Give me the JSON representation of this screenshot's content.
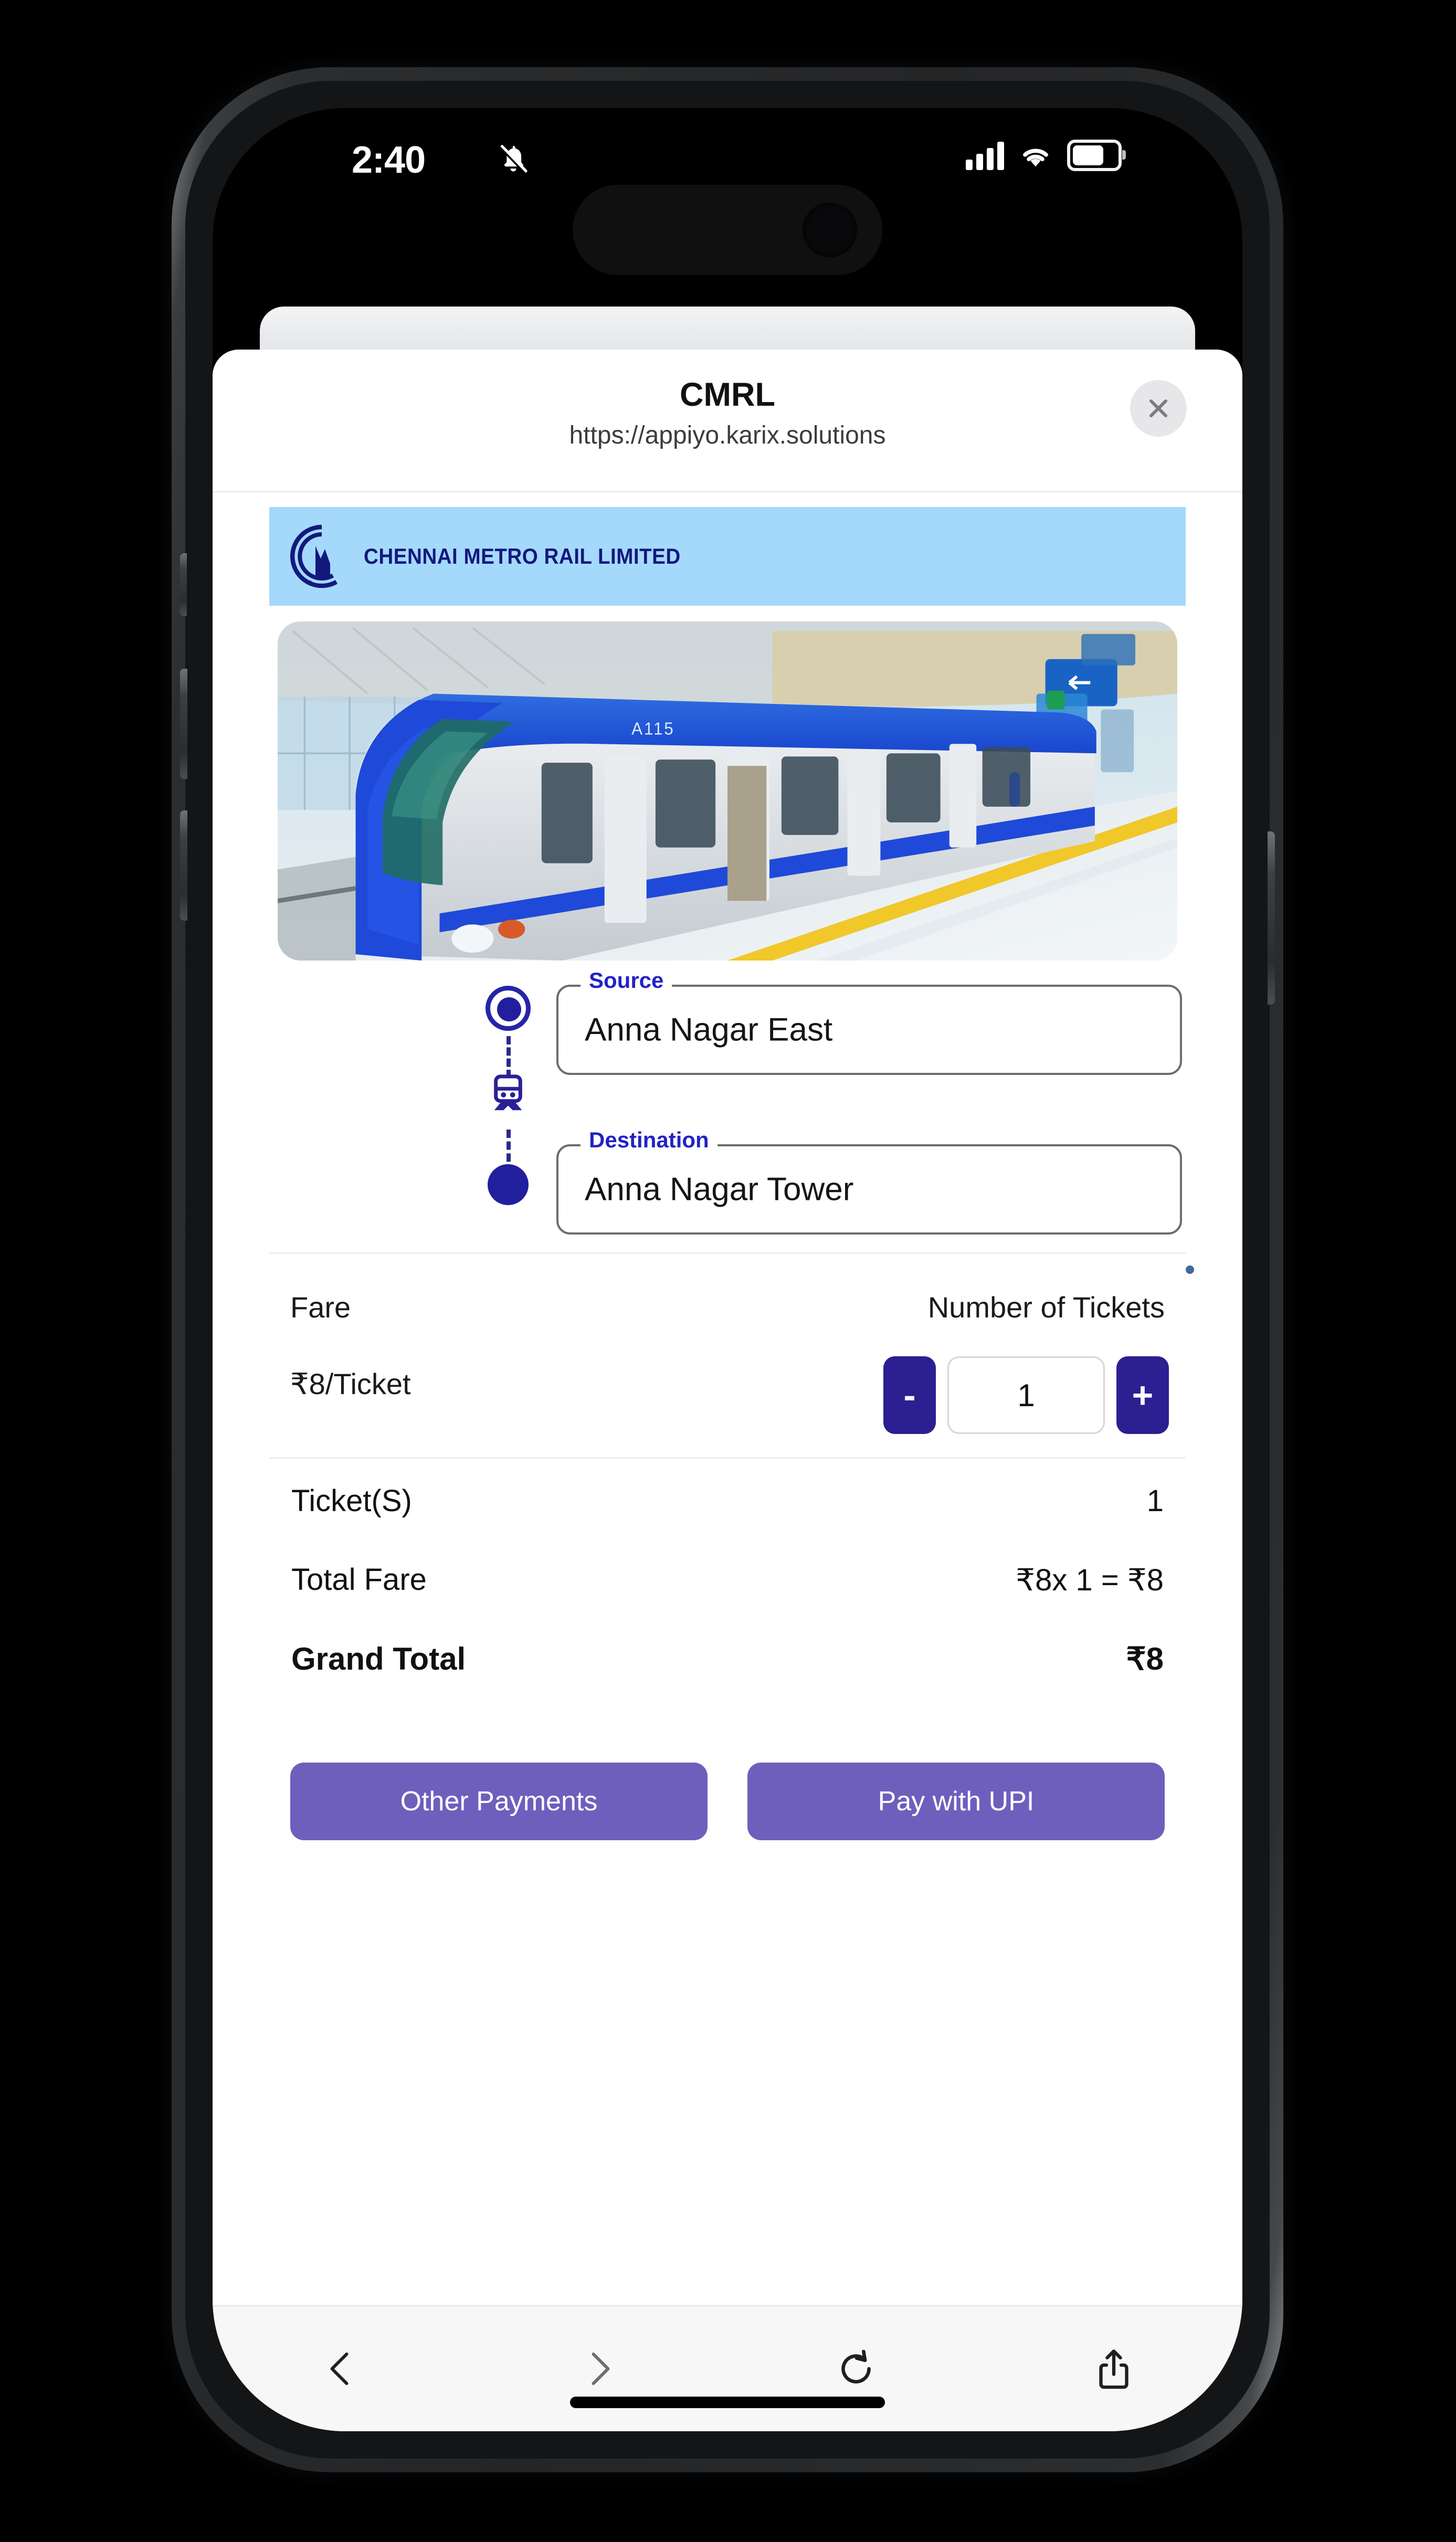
{
  "status_bar": {
    "time": "2:40",
    "icons": [
      "bell-slash-icon",
      "cellular-signal-icon",
      "wifi-icon",
      "battery-icon"
    ]
  },
  "sheet": {
    "title": "CMRL",
    "url": "https://appiyo.karix.solutions",
    "close_label": "close-icon"
  },
  "brand": {
    "name": "CHENNAI METRO RAIL LIMITED",
    "banner_color": "#a5d9fb",
    "logo_color": "#12197d"
  },
  "hero": {
    "alt": "Chennai Metro train at station platform"
  },
  "route": {
    "source": {
      "label": "Source",
      "value": "Anna Nagar East"
    },
    "destination": {
      "label": "Destination",
      "value": "Anna Nagar Tower"
    }
  },
  "fare": {
    "fare_label": "Fare",
    "fare_value": "₹8/Ticket",
    "tickets_label": "Number of Tickets",
    "decrement": "-",
    "increment": "+",
    "quantity": "1"
  },
  "summary": [
    {
      "key": "Ticket(S)",
      "value": "1"
    },
    {
      "key": "Total Fare",
      "value": "₹8x 1 = ₹8"
    },
    {
      "key": "Grand Total",
      "value": "₹8"
    }
  ],
  "actions": {
    "other": "Other Payments",
    "upi": "Pay with UPI"
  },
  "toolbar": {
    "back": "back-chevron-icon",
    "forward": "forward-chevron-icon",
    "reload": "reload-icon",
    "share": "share-icon"
  },
  "colors": {
    "accent_indigo": "#2b1f91",
    "accent_purple": "#6e5fbd",
    "label_blue": "#2222c4",
    "banner_blue": "#a5d9fb"
  }
}
